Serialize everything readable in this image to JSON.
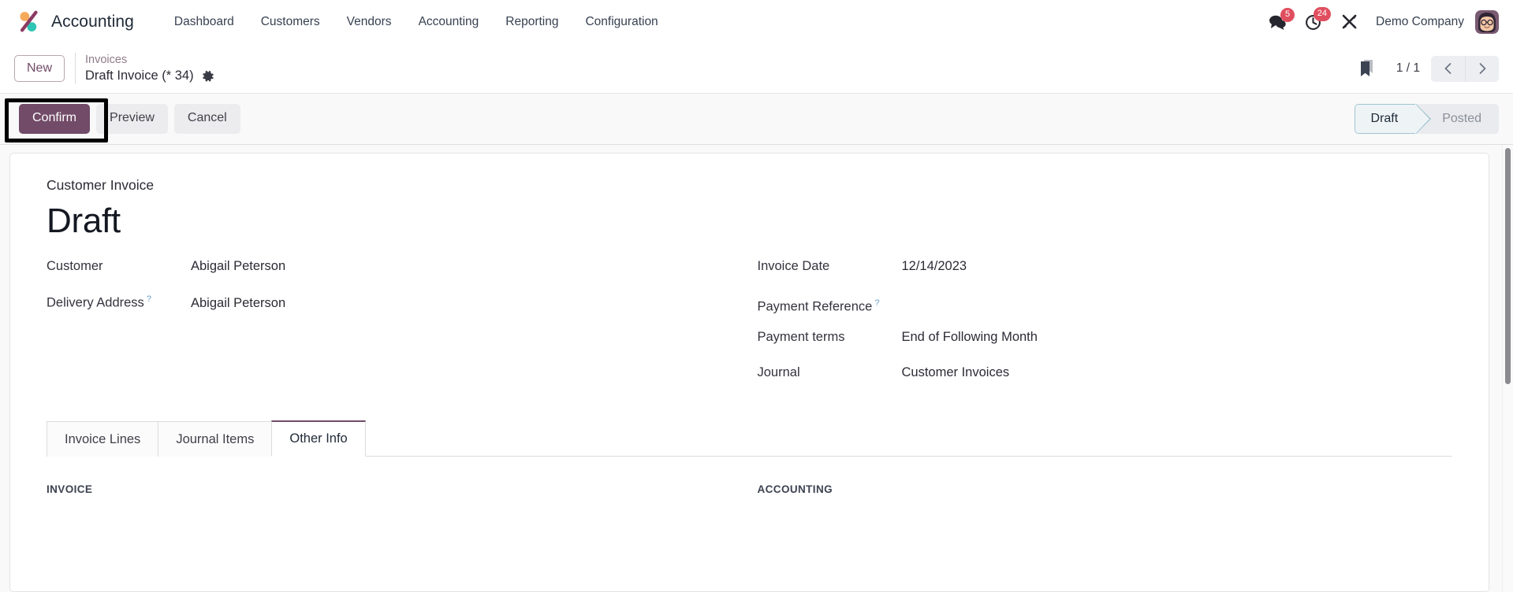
{
  "navbar": {
    "brand": "Accounting",
    "logo_icon": "odoo-accounting-logo-icon",
    "menu": [
      {
        "label": "Dashboard"
      },
      {
        "label": "Customers"
      },
      {
        "label": "Vendors"
      },
      {
        "label": "Accounting"
      },
      {
        "label": "Reporting"
      },
      {
        "label": "Configuration"
      }
    ],
    "systray": {
      "messages_icon": "chat-bubbles-icon",
      "messages_count": "5",
      "activities_icon": "clock-icon",
      "activities_count": "24",
      "tools_icon": "crossed-tools-icon",
      "company": "Demo Company",
      "avatar_icon": "user-avatar"
    }
  },
  "breadcrumb": {
    "new_label": "New",
    "parent": "Invoices",
    "current": "Draft Invoice (* 34)",
    "settings_icon": "gear-icon"
  },
  "pager": {
    "bookmark_icon": "bookmark-icon",
    "count": "1 / 1",
    "prev_icon": "chevron-left-icon",
    "next_icon": "chevron-right-icon"
  },
  "actions": {
    "confirm_label": "Confirm",
    "preview_label": "Preview",
    "cancel_label": "Cancel"
  },
  "status": {
    "steps": [
      {
        "label": "Draft",
        "state": "active"
      },
      {
        "label": "Posted",
        "state": "inactive"
      }
    ]
  },
  "form": {
    "subtitle": "Customer Invoice",
    "title": "Draft",
    "left_fields": [
      {
        "label": "Customer",
        "value": "Abigail Peterson",
        "help": ""
      },
      {
        "label": "Delivery Address",
        "value": "Abigail Peterson",
        "help": "?"
      }
    ],
    "right_fields": [
      {
        "label": "Invoice Date",
        "value": "12/14/2023",
        "help": ""
      },
      {
        "label": "Payment Reference",
        "value": "",
        "help": "?"
      },
      {
        "label": "Payment terms",
        "value": "End of Following Month",
        "help": ""
      },
      {
        "label": "Journal",
        "value": "Customer Invoices",
        "help": ""
      }
    ]
  },
  "notebook": {
    "tabs": [
      {
        "label": "Invoice Lines",
        "active": false
      },
      {
        "label": "Journal Items",
        "active": false
      },
      {
        "label": "Other Info",
        "active": true
      }
    ],
    "panel": {
      "left_section": "INVOICE",
      "right_section": "ACCOUNTING"
    }
  },
  "colors": {
    "brand_purple": "#714b67",
    "badge_red": "#e04f5f",
    "status_active_border": "#9fc4cf",
    "highlight_box": "#000000"
  }
}
